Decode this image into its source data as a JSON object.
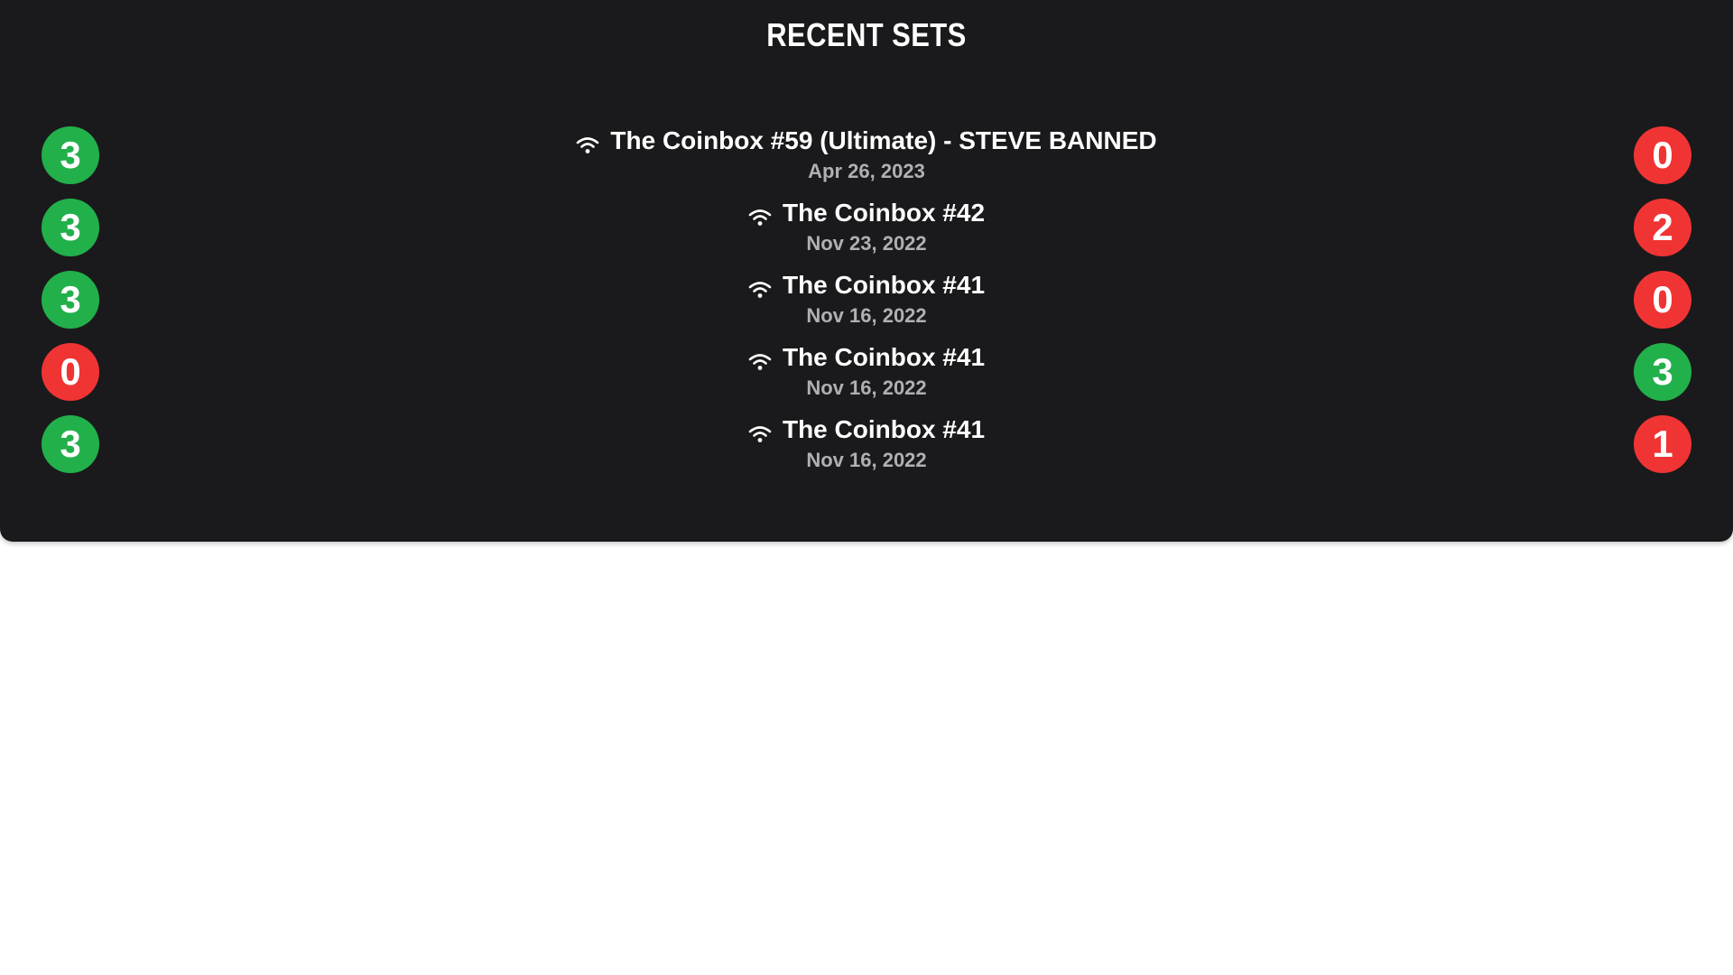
{
  "title": "RECENT SETS",
  "colors": {
    "background": "#1a1a1c",
    "win": "#22b04b",
    "loss": "#f03434",
    "date_text": "#b0b0b3"
  },
  "sets": [
    {
      "name": "The Coinbox #59 (Ultimate) - STEVE BANNED",
      "date": "Apr 26, 2023",
      "left_score": "3",
      "left_result": "win",
      "right_score": "0",
      "right_result": "loss",
      "icon": "wifi-icon"
    },
    {
      "name": "The Coinbox #42",
      "date": "Nov 23, 2022",
      "left_score": "3",
      "left_result": "win",
      "right_score": "2",
      "right_result": "loss",
      "icon": "wifi-icon"
    },
    {
      "name": "The Coinbox #41",
      "date": "Nov 16, 2022",
      "left_score": "3",
      "left_result": "win",
      "right_score": "0",
      "right_result": "loss",
      "icon": "wifi-icon"
    },
    {
      "name": "The Coinbox #41",
      "date": "Nov 16, 2022",
      "left_score": "0",
      "left_result": "loss",
      "right_score": "3",
      "right_result": "win",
      "icon": "wifi-icon"
    },
    {
      "name": "The Coinbox #41",
      "date": "Nov 16, 2022",
      "left_score": "3",
      "left_result": "win",
      "right_score": "1",
      "right_result": "loss",
      "icon": "wifi-icon"
    }
  ]
}
